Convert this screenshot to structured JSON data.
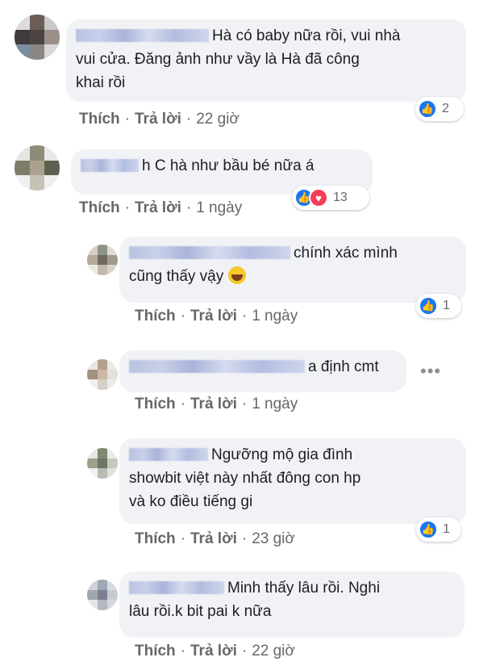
{
  "comments": [
    {
      "text_line1": "Hà có baby nữa rồi, vui nhà",
      "text_line2": "vui cửa. Đăng ảnh như vầy là Hà đã công",
      "text_line3": "khai rồi",
      "like_label": "Thích",
      "reply_label": "Trả lời",
      "time": "22 giờ",
      "reaction_count": "2",
      "avatar_colors": [
        "#dcdcdc",
        "#6b5d56",
        "#c9c9c9",
        "#3e3a3d",
        "#4a4442",
        "#9c8f8a",
        "#7a8ea3",
        "#8c8683",
        "#d8d8d8"
      ]
    },
    {
      "text_line1": "h C hà như bầu bé nữa á",
      "like_label": "Thích",
      "reply_label": "Trả lời",
      "time": "1 ngày",
      "reaction_count": "13",
      "avatar_colors": [
        "#e5e5e5",
        "#8e8b78",
        "#e8e8e8",
        "#7d7c69",
        "#a9a38e",
        "#5e6050",
        "#f0f0f0",
        "#c6c2b5",
        "#efefef"
      ]
    },
    {
      "text_line1": "chính xác mình",
      "text_line2": "cũng thấy vậy",
      "like_label": "Thích",
      "reply_label": "Trả lời",
      "time": "1 ngày",
      "reaction_count": "1",
      "avatar_colors": [
        "#d8d0c8",
        "#8e9488",
        "#e0dad4",
        "#b7a999",
        "#6e6a60",
        "#a09a8e",
        "#ece9e5",
        "#c2b9ad",
        "#d6d2cc"
      ]
    },
    {
      "text_line1": "a định cmt",
      "like_label": "Thích",
      "reply_label": "Trả lời",
      "time": "1 ngày",
      "more": "•••",
      "avatar_colors": [
        "#e8e6e3",
        "#b49f8a",
        "#ebe9e6",
        "#a39180",
        "#cbb8a4",
        "#e2e0dc",
        "#f1f0ee",
        "#d5cfc9",
        "#eceae7"
      ]
    },
    {
      "text_line1": "Ngưỡng mộ gia đình",
      "text_line2": "showbit việt này nhất đông con hp",
      "text_line3": "và ko điều tiếng gi",
      "like_label": "Thích",
      "reply_label": "Trả lời",
      "time": "23 giờ",
      "reaction_count": "1",
      "avatar_colors": [
        "#e4e6e2",
        "#7f8a70",
        "#e9ebe7",
        "#9aa28c",
        "#6c7664",
        "#c4c9bc",
        "#f0f1ee",
        "#b8bdb0",
        "#dfe1dc"
      ]
    },
    {
      "text_line1": "Minh thấy lâu rồi. Nghi",
      "text_line2": "lâu rồi.k bit pai k nữa",
      "like_label": "Thích",
      "reply_label": "Trả lời",
      "time": "22 giờ",
      "avatar_colors": [
        "#cfd2d6",
        "#9fa8b4",
        "#d9dbde",
        "#a2a6ad",
        "#7b8190",
        "#c7cbd1",
        "#e3e5e8",
        "#b3b8c0",
        "#d4d7db"
      ]
    }
  ]
}
